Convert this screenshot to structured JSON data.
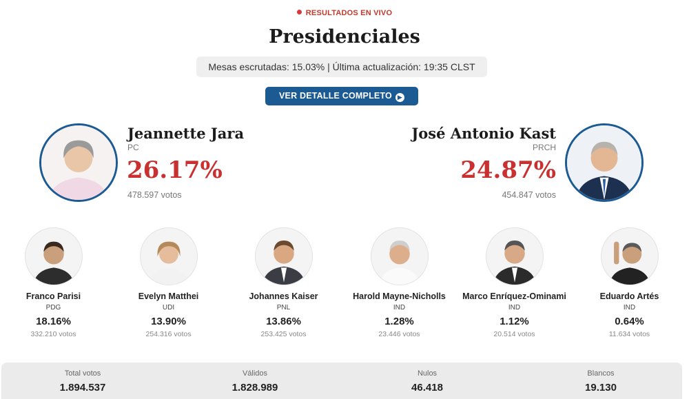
{
  "header": {
    "live_label": "RESULTADOS EN VIVO",
    "title": "Presidenciales",
    "status": "Mesas escrutadas: 15.03% | Última actualización: 19:35 CLST",
    "detail_button": "VER DETALLE COMPLETO"
  },
  "leaders": [
    {
      "name": "Jeannette Jara",
      "party": "PC",
      "pct": "26.17%",
      "votes": "478.597 votos"
    },
    {
      "name": "José Antonio Kast",
      "party": "PRCH",
      "pct": "24.87%",
      "votes": "454.847 votos"
    }
  ],
  "candidates": [
    {
      "name": "Franco Parisi",
      "party": "PDG",
      "pct": "18.16%",
      "votes": "332.210 votos"
    },
    {
      "name": "Evelyn Matthei",
      "party": "UDI",
      "pct": "13.90%",
      "votes": "254.316 votos"
    },
    {
      "name": "Johannes Kaiser",
      "party": "PNL",
      "pct": "13.86%",
      "votes": "253.425 votos"
    },
    {
      "name": "Harold Mayne-Nicholls",
      "party": "IND",
      "pct": "1.28%",
      "votes": "23.446 votos"
    },
    {
      "name": "Marco Enríquez-Ominami",
      "party": "IND",
      "pct": "1.12%",
      "votes": "20.514 votos"
    },
    {
      "name": "Eduardo Artés",
      "party": "IND",
      "pct": "0.64%",
      "votes": "11.634 votos"
    }
  ],
  "totals": [
    {
      "label": "Total votos",
      "value": "1.894.537"
    },
    {
      "label": "Válidos",
      "value": "1.828.989"
    },
    {
      "label": "Nulos",
      "value": "46.418"
    },
    {
      "label": "Blancos",
      "value": "19.130"
    }
  ],
  "colors": {
    "accent": "#1b5a93",
    "percent_red": "#c8312f",
    "live_red": "#d63a3a"
  }
}
